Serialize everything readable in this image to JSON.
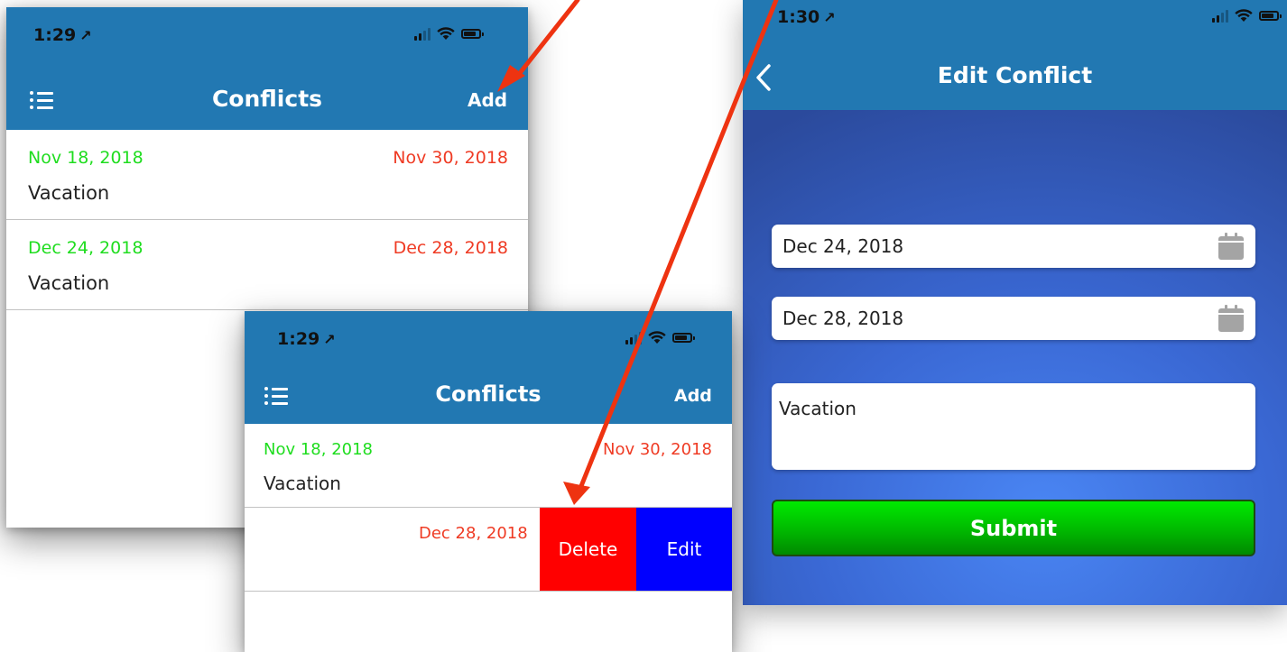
{
  "colors": {
    "header_blue": "#2278b2",
    "start_green": "#1fdd1f",
    "end_red": "#ef3b24",
    "delete_red": "#ff0000",
    "edit_blue": "#0000ff",
    "submit_green": "#00cc00",
    "annotation_arrow": "#ee3311"
  },
  "list_screen": {
    "status": {
      "time": "1:29",
      "location_arrow": "↗"
    },
    "header": {
      "title": "Conflicts",
      "add_label": "Add",
      "menu_icon": "list-icon"
    },
    "items": [
      {
        "start": "Nov 18, 2018",
        "end": "Nov 30, 2018",
        "reason": "Vacation"
      },
      {
        "start": "Dec 24, 2018",
        "end": "Dec 28, 2018",
        "reason": "Vacation"
      }
    ]
  },
  "swipe_screen": {
    "status": {
      "time": "1:29",
      "location_arrow": "↗"
    },
    "header": {
      "title": "Conflicts",
      "add_label": "Add",
      "menu_icon": "list-icon"
    },
    "items": [
      {
        "start": "Nov 18, 2018",
        "end": "Nov 30, 2018",
        "reason": "Vacation"
      },
      {
        "end": "Dec 28, 2018"
      }
    ],
    "actions": {
      "delete_label": "Delete",
      "edit_label": "Edit"
    }
  },
  "edit_screen": {
    "status": {
      "time": "1:30",
      "location_arrow": "↗"
    },
    "header": {
      "title": "Edit Conflict",
      "back_icon": "chevron-left-icon"
    },
    "start_date": "Dec 24, 2018",
    "end_date": "Dec 28, 2018",
    "reason": "Vacation",
    "submit_label": "Submit",
    "calendar_icon": "calendar-icon"
  }
}
